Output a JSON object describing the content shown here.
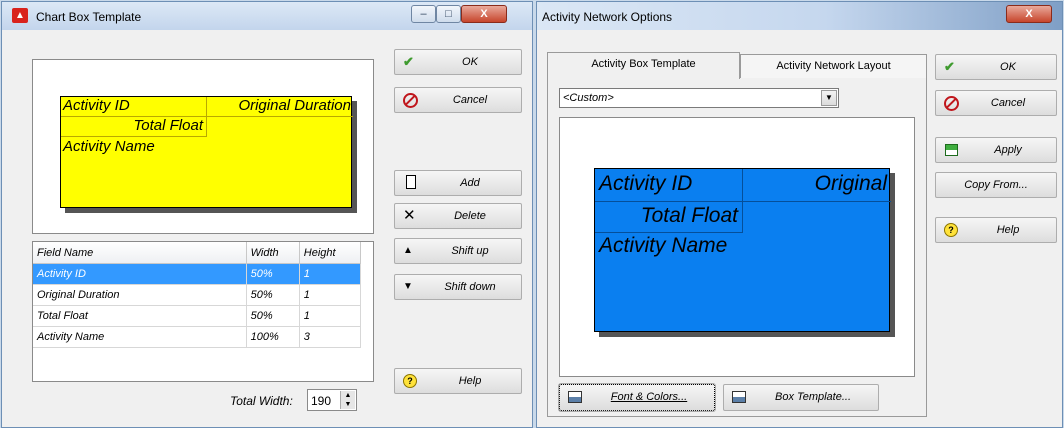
{
  "left_window": {
    "title": "Chart Box Template",
    "preview": {
      "activity_id": "Activity ID",
      "original_duration": "Original Duration",
      "total_float": "Total Float",
      "activity_name": "Activity Name",
      "fill_color": "#ffff00"
    },
    "table": {
      "headers": [
        "Field Name",
        "Width",
        "Height"
      ],
      "rows": [
        {
          "field": "Activity ID",
          "width": "50%",
          "height": "1"
        },
        {
          "field": "Original Duration",
          "width": "50%",
          "height": "1"
        },
        {
          "field": "Total Float",
          "width": "50%",
          "height": "1"
        },
        {
          "field": "Activity Name",
          "width": "100%",
          "height": "3"
        }
      ],
      "selected_index": 0
    },
    "total_width_label": "Total Width:",
    "total_width_value": "190",
    "buttons": {
      "ok": "OK",
      "cancel": "Cancel",
      "add": "Add",
      "delete": "Delete",
      "shift_up": "Shift up",
      "shift_down": "Shift down",
      "help": "Help"
    }
  },
  "right_window": {
    "title": "Activity Network Options",
    "tabs": [
      "Activity Box Template",
      "Activity Network Layout"
    ],
    "active_tab": 0,
    "template_select": "<Custom>",
    "preview": {
      "activity_id": "Activity ID",
      "original": "Original",
      "total_float": "Total Float",
      "activity_name": "Activity Name",
      "fill_color": "#0a7ff0"
    },
    "buttons": {
      "ok": "OK",
      "cancel": "Cancel",
      "apply": "Apply",
      "copy_from": "Copy From...",
      "help": "Help",
      "font_colors": "Font & Colors...",
      "box_template": "Box Template..."
    }
  },
  "colors": {
    "selection": "#3399ff",
    "close_button": "#c7452c"
  }
}
